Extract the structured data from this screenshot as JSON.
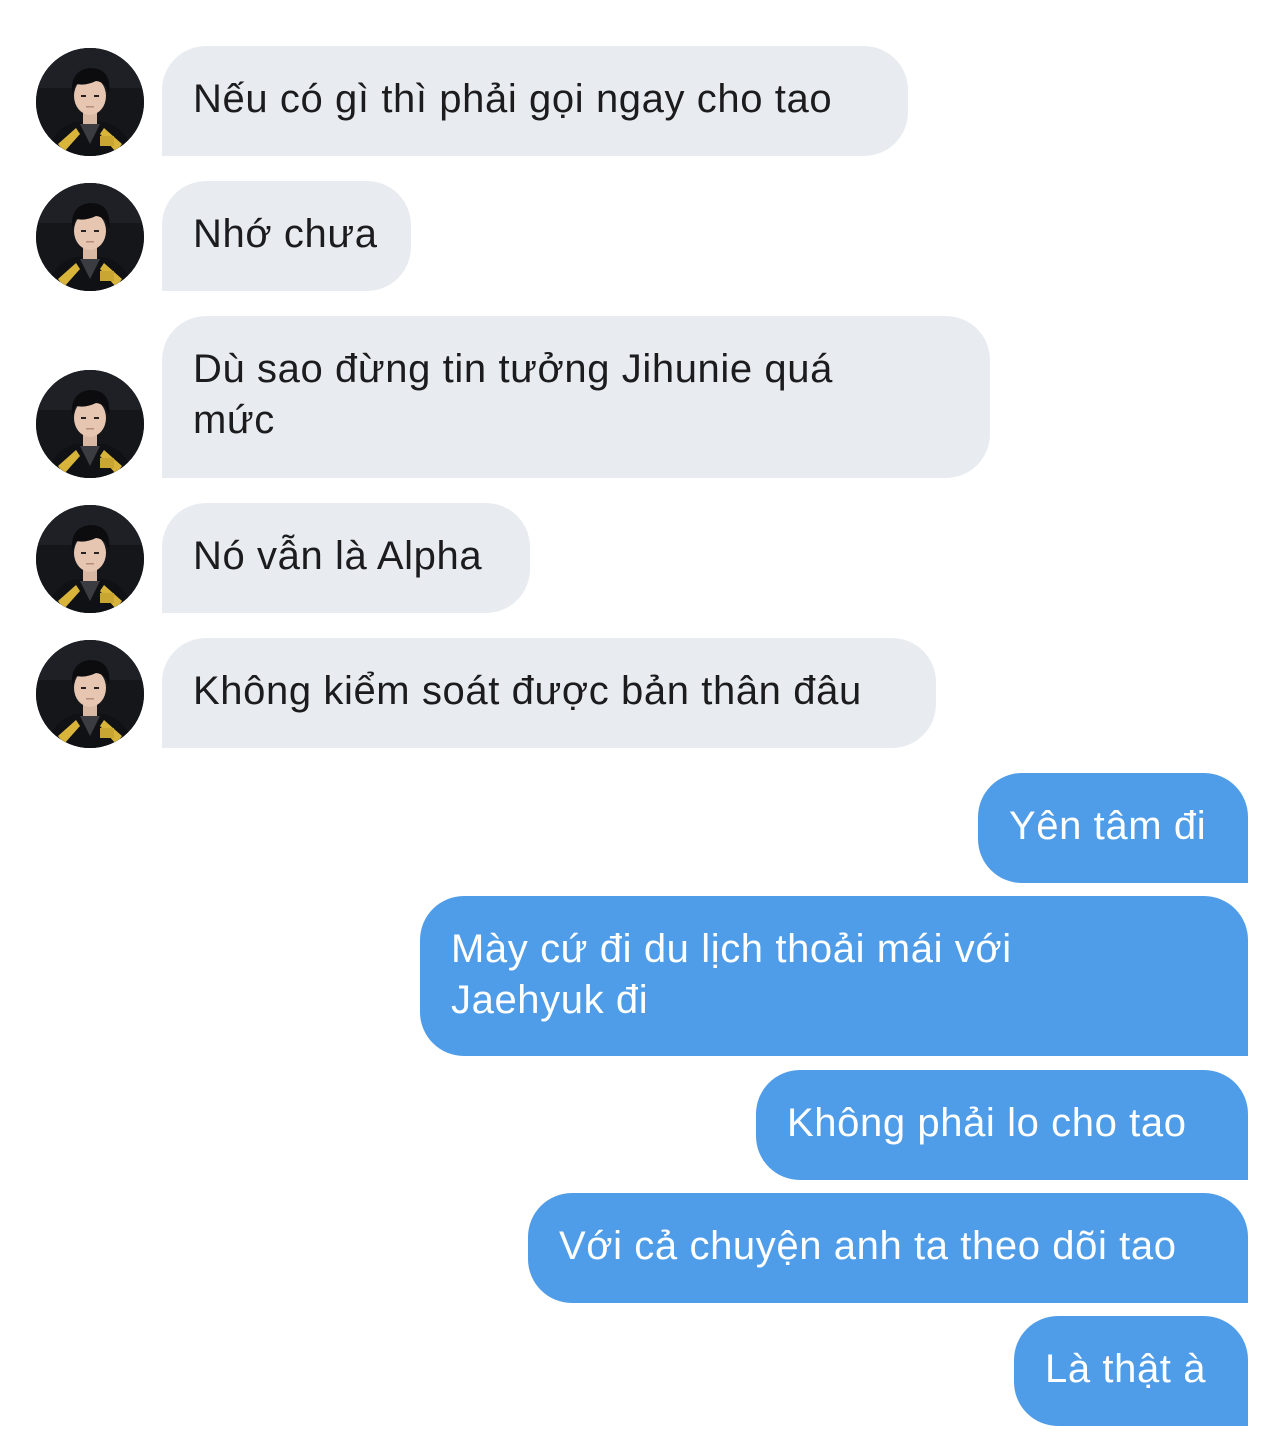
{
  "conversation": {
    "incoming": [
      {
        "text": "Nếu có gì thì phải gọi ngay cho tao"
      },
      {
        "text": "Nhớ chưa"
      },
      {
        "text": "Dù sao đừng tin tưởng Jihunie quá mức"
      },
      {
        "text": "Nó vẫn là Alpha"
      },
      {
        "text": "Không kiểm soát được bản thân đâu"
      }
    ],
    "outgoing": [
      {
        "text": "Yên tâm đi"
      },
      {
        "text": "Mày cứ đi du lịch thoải mái với Jaehyuk đi"
      },
      {
        "text": "Không phải lo cho tao"
      },
      {
        "text": "Với cả chuyện anh ta theo dõi tao"
      },
      {
        "text": "Là thật à"
      }
    ]
  },
  "avatar": {
    "icon": "contact-avatar-photo"
  },
  "colors": {
    "incoming_bubble": "#e8ecf0",
    "incoming_text": "#1c1c1e",
    "outgoing_bubble": "#4f9de8",
    "outgoing_text": "#ffffff"
  }
}
